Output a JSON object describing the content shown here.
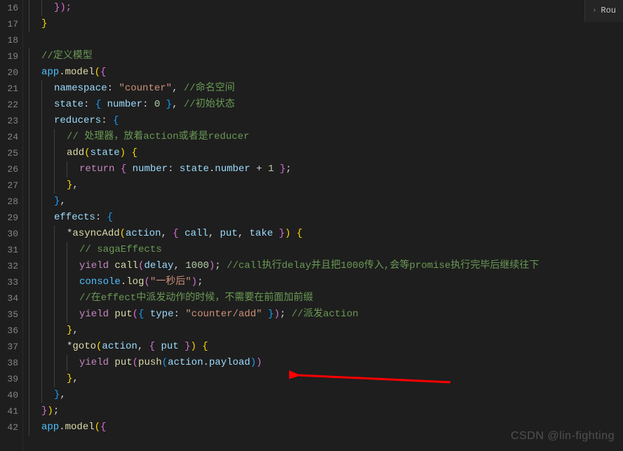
{
  "editor": {
    "startLine": 16,
    "lines": [
      {
        "n": 16,
        "indent": 3,
        "tokens": [
          {
            "t": "});",
            "c": "brace2"
          }
        ]
      },
      {
        "n": 17,
        "indent": 2,
        "tokens": [
          {
            "t": "}",
            "c": "brace"
          }
        ]
      },
      {
        "n": 18,
        "indent": 1,
        "tokens": []
      },
      {
        "n": 19,
        "indent": 2,
        "tokens": [
          {
            "t": "//定义模型",
            "c": "comment"
          }
        ]
      },
      {
        "n": 20,
        "indent": 2,
        "tokens": [
          {
            "t": "app",
            "c": "object"
          },
          {
            "t": ".",
            "c": "punct"
          },
          {
            "t": "model",
            "c": "method"
          },
          {
            "t": "(",
            "c": "brace"
          },
          {
            "t": "{",
            "c": "brace2"
          }
        ]
      },
      {
        "n": 21,
        "indent": 3,
        "tokens": [
          {
            "t": "namespace",
            "c": "prop"
          },
          {
            "t": ": ",
            "c": "punct"
          },
          {
            "t": "\"counter\"",
            "c": "string"
          },
          {
            "t": ", ",
            "c": "punct"
          },
          {
            "t": "//命名空间",
            "c": "comment"
          }
        ]
      },
      {
        "n": 22,
        "indent": 3,
        "tokens": [
          {
            "t": "state",
            "c": "prop"
          },
          {
            "t": ": ",
            "c": "punct"
          },
          {
            "t": "{ ",
            "c": "brace3"
          },
          {
            "t": "number",
            "c": "prop"
          },
          {
            "t": ": ",
            "c": "punct"
          },
          {
            "t": "0",
            "c": "number"
          },
          {
            "t": " }",
            "c": "brace3"
          },
          {
            "t": ", ",
            "c": "punct"
          },
          {
            "t": "//初始状态",
            "c": "comment"
          }
        ]
      },
      {
        "n": 23,
        "indent": 3,
        "tokens": [
          {
            "t": "reducers",
            "c": "prop"
          },
          {
            "t": ": ",
            "c": "punct"
          },
          {
            "t": "{",
            "c": "brace3"
          }
        ]
      },
      {
        "n": 24,
        "indent": 4,
        "tokens": [
          {
            "t": "// 处理器，放着action或者是reducer",
            "c": "comment"
          }
        ]
      },
      {
        "n": 25,
        "indent": 4,
        "tokens": [
          {
            "t": "add",
            "c": "method"
          },
          {
            "t": "(",
            "c": "brace"
          },
          {
            "t": "state",
            "c": "param"
          },
          {
            "t": ")",
            "c": "brace"
          },
          {
            "t": " {",
            "c": "brace"
          }
        ]
      },
      {
        "n": 26,
        "indent": 5,
        "tokens": [
          {
            "t": "return",
            "c": "keyword"
          },
          {
            "t": " { ",
            "c": "brace2"
          },
          {
            "t": "number",
            "c": "prop"
          },
          {
            "t": ": ",
            "c": "punct"
          },
          {
            "t": "state",
            "c": "param"
          },
          {
            "t": ".",
            "c": "punct"
          },
          {
            "t": "number",
            "c": "prop"
          },
          {
            "t": " + ",
            "c": "operator"
          },
          {
            "t": "1",
            "c": "number"
          },
          {
            "t": " }",
            "c": "brace2"
          },
          {
            "t": ";",
            "c": "punct"
          }
        ]
      },
      {
        "n": 27,
        "indent": 4,
        "tokens": [
          {
            "t": "}",
            "c": "brace"
          },
          {
            "t": ",",
            "c": "punct"
          }
        ]
      },
      {
        "n": 28,
        "indent": 3,
        "tokens": [
          {
            "t": "}",
            "c": "brace3"
          },
          {
            "t": ",",
            "c": "punct"
          }
        ]
      },
      {
        "n": 29,
        "indent": 3,
        "tokens": [
          {
            "t": "effects",
            "c": "prop"
          },
          {
            "t": ": ",
            "c": "punct"
          },
          {
            "t": "{",
            "c": "brace3"
          }
        ]
      },
      {
        "n": 30,
        "indent": 4,
        "tokens": [
          {
            "t": "*",
            "c": "punct"
          },
          {
            "t": "asyncAdd",
            "c": "method"
          },
          {
            "t": "(",
            "c": "brace"
          },
          {
            "t": "action",
            "c": "param"
          },
          {
            "t": ", ",
            "c": "punct"
          },
          {
            "t": "{ ",
            "c": "brace2"
          },
          {
            "t": "call",
            "c": "param"
          },
          {
            "t": ", ",
            "c": "punct"
          },
          {
            "t": "put",
            "c": "param"
          },
          {
            "t": ", ",
            "c": "punct"
          },
          {
            "t": "take",
            "c": "param"
          },
          {
            "t": " }",
            "c": "brace2"
          },
          {
            "t": ")",
            "c": "brace"
          },
          {
            "t": " {",
            "c": "brace"
          }
        ]
      },
      {
        "n": 31,
        "indent": 5,
        "tokens": [
          {
            "t": "// sagaEffects",
            "c": "comment"
          }
        ]
      },
      {
        "n": 32,
        "indent": 5,
        "tokens": [
          {
            "t": "yield",
            "c": "keyword"
          },
          {
            "t": " ",
            "c": "punct"
          },
          {
            "t": "call",
            "c": "method"
          },
          {
            "t": "(",
            "c": "brace2"
          },
          {
            "t": "delay",
            "c": "param"
          },
          {
            "t": ", ",
            "c": "punct"
          },
          {
            "t": "1000",
            "c": "number"
          },
          {
            "t": ")",
            "c": "brace2"
          },
          {
            "t": "; ",
            "c": "punct"
          },
          {
            "t": "//call执行delay并且把1000传入,会等promise执行完毕后继续往下",
            "c": "comment"
          }
        ]
      },
      {
        "n": 33,
        "indent": 5,
        "tokens": [
          {
            "t": "console",
            "c": "object"
          },
          {
            "t": ".",
            "c": "punct"
          },
          {
            "t": "log",
            "c": "method"
          },
          {
            "t": "(",
            "c": "brace2"
          },
          {
            "t": "\"一秒后\"",
            "c": "string"
          },
          {
            "t": ")",
            "c": "brace2"
          },
          {
            "t": ";",
            "c": "punct"
          }
        ]
      },
      {
        "n": 34,
        "indent": 5,
        "tokens": [
          {
            "t": "//在effect中派发动作的时候，不需要在前面加前缀",
            "c": "comment"
          }
        ]
      },
      {
        "n": 35,
        "indent": 5,
        "tokens": [
          {
            "t": "yield",
            "c": "keyword"
          },
          {
            "t": " ",
            "c": "punct"
          },
          {
            "t": "put",
            "c": "method"
          },
          {
            "t": "(",
            "c": "brace2"
          },
          {
            "t": "{ ",
            "c": "brace3"
          },
          {
            "t": "type",
            "c": "prop"
          },
          {
            "t": ": ",
            "c": "punct"
          },
          {
            "t": "\"counter/add\"",
            "c": "string"
          },
          {
            "t": " }",
            "c": "brace3"
          },
          {
            "t": ")",
            "c": "brace2"
          },
          {
            "t": "; ",
            "c": "punct"
          },
          {
            "t": "//派发action",
            "c": "comment"
          }
        ]
      },
      {
        "n": 36,
        "indent": 4,
        "tokens": [
          {
            "t": "}",
            "c": "brace"
          },
          {
            "t": ",",
            "c": "punct"
          }
        ]
      },
      {
        "n": 37,
        "indent": 4,
        "tokens": [
          {
            "t": "*",
            "c": "punct"
          },
          {
            "t": "goto",
            "c": "method"
          },
          {
            "t": "(",
            "c": "brace"
          },
          {
            "t": "action",
            "c": "param"
          },
          {
            "t": ", ",
            "c": "punct"
          },
          {
            "t": "{ ",
            "c": "brace2"
          },
          {
            "t": "put",
            "c": "param"
          },
          {
            "t": " }",
            "c": "brace2"
          },
          {
            "t": ")",
            "c": "brace"
          },
          {
            "t": " {",
            "c": "brace"
          }
        ]
      },
      {
        "n": 38,
        "indent": 5,
        "tokens": [
          {
            "t": "yield",
            "c": "keyword"
          },
          {
            "t": " ",
            "c": "punct"
          },
          {
            "t": "put",
            "c": "method"
          },
          {
            "t": "(",
            "c": "brace2"
          },
          {
            "t": "push",
            "c": "method"
          },
          {
            "t": "(",
            "c": "brace3"
          },
          {
            "t": "action",
            "c": "param"
          },
          {
            "t": ".",
            "c": "punct"
          },
          {
            "t": "payload",
            "c": "prop"
          },
          {
            "t": ")",
            "c": "brace3"
          },
          {
            "t": ")",
            "c": "brace2"
          }
        ]
      },
      {
        "n": 39,
        "indent": 4,
        "tokens": [
          {
            "t": "}",
            "c": "brace"
          },
          {
            "t": ",",
            "c": "punct"
          }
        ]
      },
      {
        "n": 40,
        "indent": 3,
        "tokens": [
          {
            "t": "}",
            "c": "brace3"
          },
          {
            "t": ",",
            "c": "punct"
          }
        ]
      },
      {
        "n": 41,
        "indent": 2,
        "tokens": [
          {
            "t": "}",
            "c": "brace2"
          },
          {
            "t": ")",
            "c": "brace"
          },
          {
            "t": ";",
            "c": "punct"
          }
        ]
      },
      {
        "n": 42,
        "indent": 2,
        "tokens": [
          {
            "t": "app",
            "c": "object"
          },
          {
            "t": ".",
            "c": "punct"
          },
          {
            "t": "model",
            "c": "method"
          },
          {
            "t": "(",
            "c": "brace"
          },
          {
            "t": "{",
            "c": "brace2"
          }
        ]
      }
    ]
  },
  "topTab": {
    "label": "Rou"
  },
  "watermark": "CSDN @lin-fighting",
  "arrow": {
    "color": "#ff0000"
  }
}
